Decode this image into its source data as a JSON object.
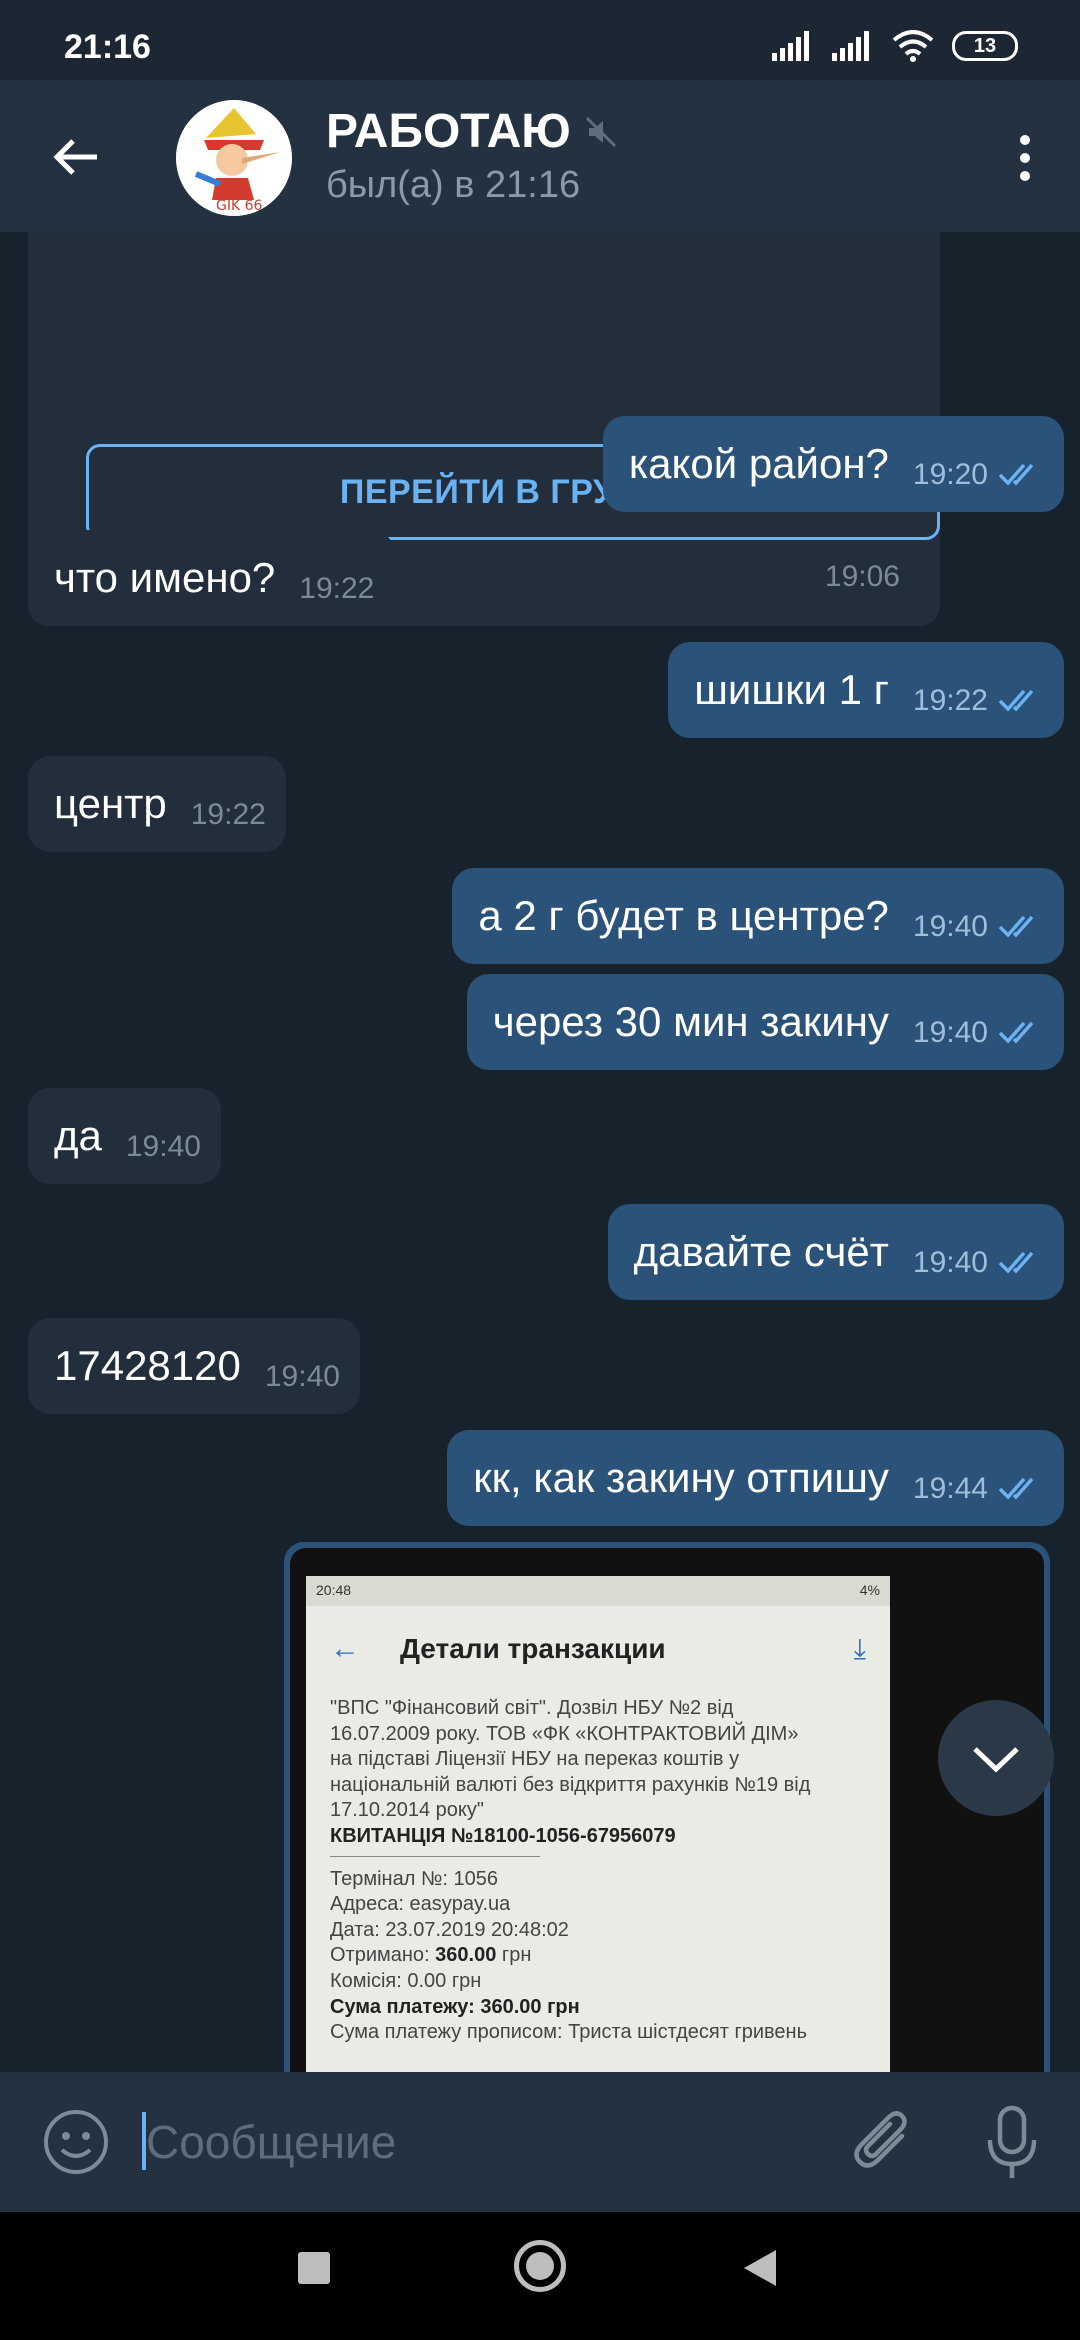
{
  "status_bar": {
    "time": "21:16",
    "battery": "13"
  },
  "header": {
    "title": "РАБОТАЮ",
    "subtitle": "был(а) в 21:16",
    "avatar_caption": "GIK 66"
  },
  "group_card": {
    "button_label": "ПЕРЕЙТИ В ГРУППУ",
    "time": "19:06"
  },
  "messages": [
    {
      "dir": "out",
      "text": "какой район?",
      "time": "19:20"
    },
    {
      "dir": "in",
      "text": "что имено?",
      "time": "19:22"
    },
    {
      "dir": "out",
      "text": "шишки 1 г",
      "time": "19:22"
    },
    {
      "dir": "in",
      "text": "центр",
      "time": "19:22"
    },
    {
      "dir": "out",
      "text": "а 2 г будет в центре?",
      "time": "19:40"
    },
    {
      "dir": "out",
      "text": "через 30 мин закину",
      "time": "19:40"
    },
    {
      "dir": "in",
      "text": "да",
      "time": "19:40"
    },
    {
      "dir": "out",
      "text": "давайте счёт",
      "time": "19:40"
    },
    {
      "dir": "in",
      "text": "17428120",
      "time": "19:40"
    },
    {
      "dir": "out",
      "text": "кк, как закину отпишу",
      "time": "19:44"
    }
  ],
  "photo": {
    "status_time": "20:48",
    "status_battery": "4%",
    "title": "Детали транзакции",
    "lines": [
      "\"ВПС \"Фінансовий світ\". Дозвіл НБУ №2 від",
      "16.07.2009 року. ТОВ «ФК «КОНТРАКТОВИЙ ДІМ»",
      "на підставі Ліцензії НБУ на переказ коштів у",
      "національній валюті без відкриття рахунків №19 від",
      "17.10.2014 року\""
    ],
    "receipt": "КВИТАНЦІЯ №18100-1056-67956079",
    "terminal": "Термінал №: 1056",
    "address": "Адреса: easypay.ua",
    "date": "Дата: 23.07.2019 20:48:02",
    "received_label": "Отримано: ",
    "received_value": "360.00",
    "received_unit": " грн",
    "commission": "Комісія: 0.00 грн",
    "sum_label": "Сума платежу: ",
    "sum_value": "360.00",
    "sum_unit": " грн",
    "cut_line": "Сума платежу прописом: Триста шістдесят гривень"
  },
  "input": {
    "placeholder": "Сообщение"
  },
  "colors": {
    "accent": "#6ab2f2",
    "bubble_in": "#222e3b",
    "bubble_out": "#2b5278",
    "background": "#18222d"
  }
}
